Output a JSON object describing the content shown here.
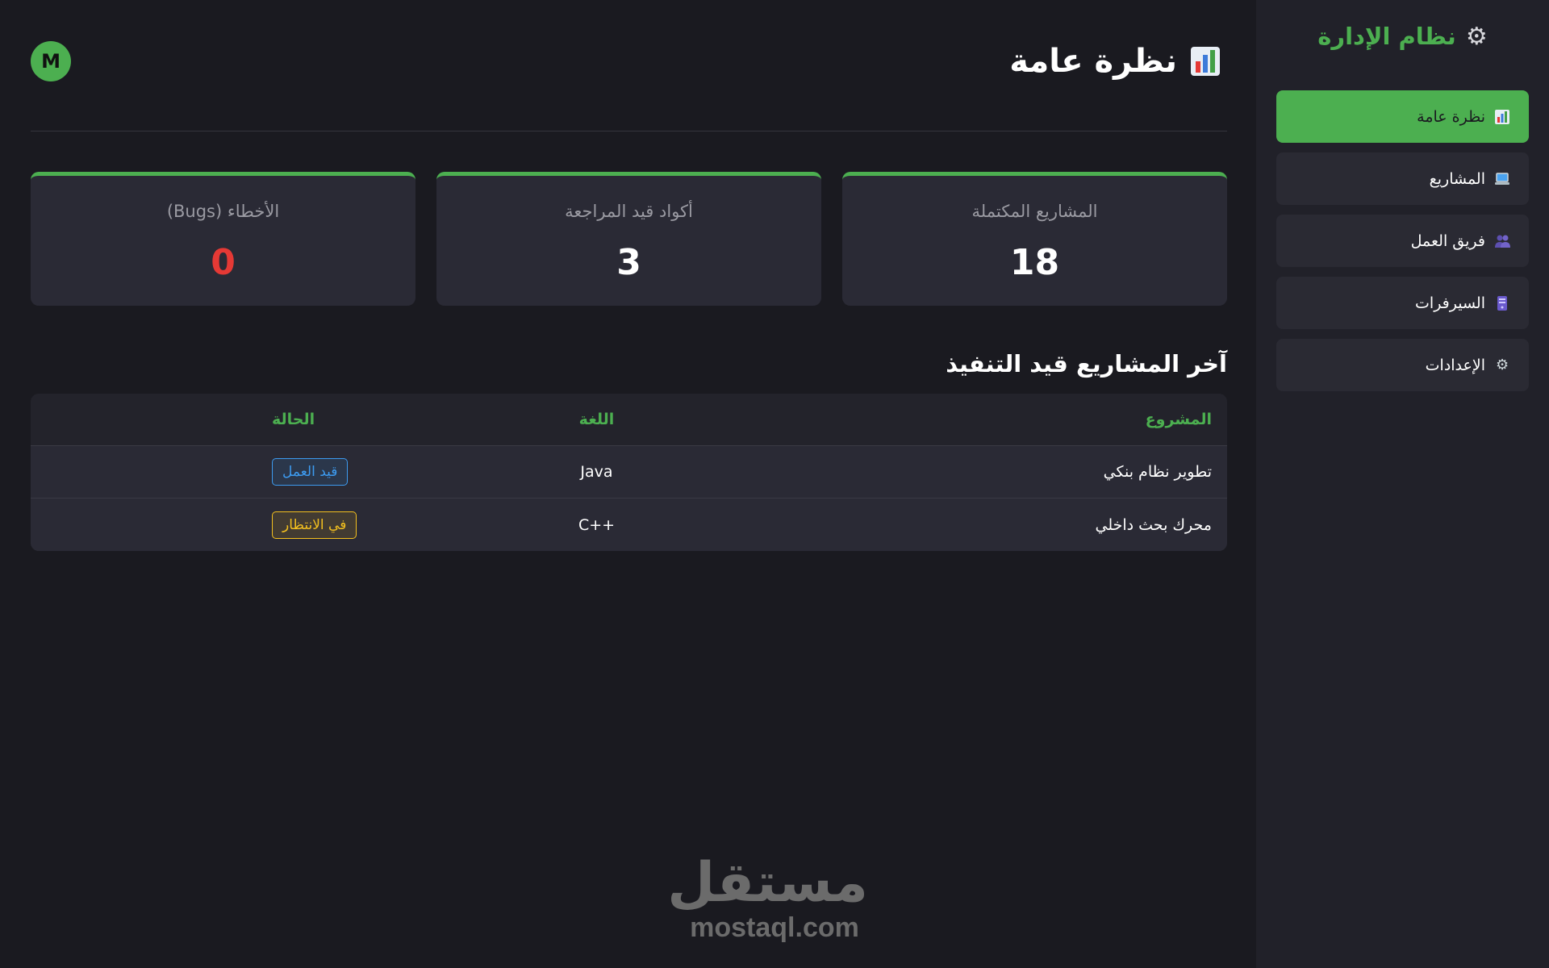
{
  "sidebar": {
    "brand_icon": "gear-icon",
    "brand_title": "نظام الإدارة",
    "items": [
      {
        "label": "نظرة عامة",
        "icon": "bar-chart-icon",
        "active": true
      },
      {
        "label": "المشاريع",
        "icon": "laptop-icon",
        "active": false
      },
      {
        "label": "فريق العمل",
        "icon": "people-icon",
        "active": false
      },
      {
        "label": "السيرفرات",
        "icon": "server-icon",
        "active": false
      },
      {
        "label": "الإعدادات",
        "icon": "gear-icon",
        "active": false
      }
    ]
  },
  "header": {
    "title": "نظرة عامة",
    "title_icon": "bar-chart-icon",
    "avatar_initial": "M"
  },
  "stats": [
    {
      "label": "المشاريع المكتملة",
      "value": "18"
    },
    {
      "label": "أكواد قيد المراجعة",
      "value": "3"
    },
    {
      "label": "الأخطاء (Bugs)",
      "value": "0"
    }
  ],
  "projects": {
    "title": "آخر المشاريع قيد التنفيذ",
    "columns": [
      "المشروع",
      "اللغة",
      "الحالة"
    ],
    "rows": [
      {
        "project": "تطوير نظام بنكي",
        "language": "Java",
        "status": "قيد العمل",
        "status_color": "#3d9bf0"
      },
      {
        "project": "محرك بحث داخلي",
        "language": "C++",
        "status": "في الانتظار",
        "status_color": "#f4c01e"
      }
    ]
  },
  "watermark": {
    "arabic": "مستقل",
    "latin": "mostaql.com"
  },
  "colors": {
    "accent": "#4caf50",
    "danger": "#e53935",
    "background": "#1a1a20",
    "sidebar": "#212129",
    "card": "#2a2a35"
  }
}
